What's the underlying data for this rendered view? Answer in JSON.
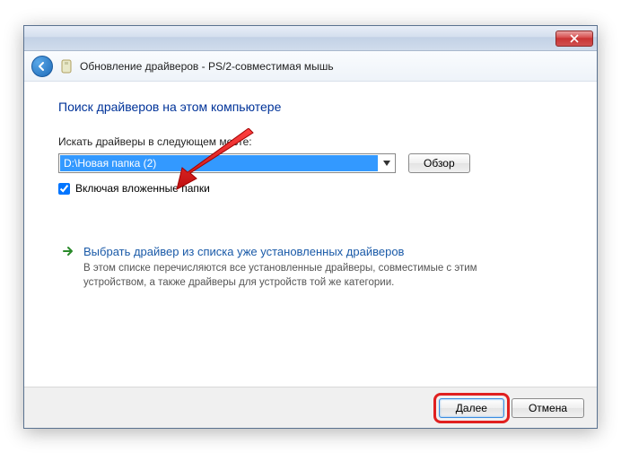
{
  "window": {
    "title": "Обновление драйверов - PS/2-совместимая мышь"
  },
  "main": {
    "heading": "Поиск драйверов на этом компьютере",
    "search_label": "Искать драйверы в следующем месте:",
    "path_value": "D:\\Новая папка (2)",
    "browse_label": "Обзор",
    "include_subfolders_label": "Включая вложенные папки",
    "include_subfolders_checked": true
  },
  "option": {
    "title": "Выбрать драйвер из списка уже установленных драйверов",
    "desc": "В этом списке перечисляются все установленные драйверы, совместимые с этим устройством, а также драйверы для устройств той же категории."
  },
  "footer": {
    "next_label": "Далее",
    "cancel_label": "Отмена"
  }
}
